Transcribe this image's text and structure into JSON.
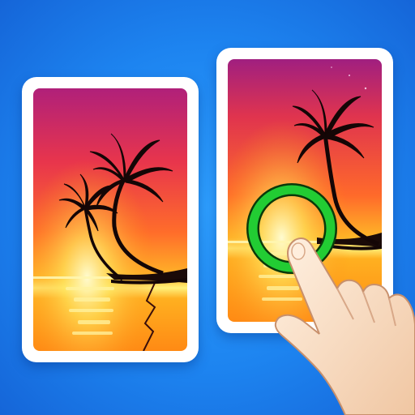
{
  "scene": {
    "background_color": "#1d84f0",
    "left_card": {
      "image": "sunset-beach-with-two-palm-trees",
      "palm_tree_count": 2
    },
    "right_card": {
      "image": "sunset-beach-with-one-palm-tree",
      "palm_tree_count": 1,
      "found_difference_marker": {
        "shape": "circle",
        "color": "#22cc33"
      }
    },
    "pointer": {
      "icon": "tapping-hand-icon"
    }
  },
  "colors": {
    "sky_top": "#a0217a",
    "sky_mid": "#e8404a",
    "sky_low": "#ff9a1e",
    "horizon": "#ffe066",
    "marker": "#22cc33",
    "card_frame": "#ffffff"
  }
}
